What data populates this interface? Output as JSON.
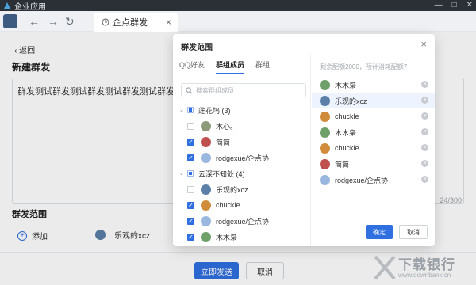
{
  "app": {
    "title": "企业应用"
  },
  "tab": {
    "label": "企点群发"
  },
  "page": {
    "back_label": "返回",
    "title": "新建群发",
    "message": "群发测试群发测试群发测试群发测试群发测试群发测试",
    "counter": "24/300",
    "range_title": "群发范围",
    "add_label": "添加",
    "selected_member": "乐观的xcz",
    "send_label": "立即发送",
    "cancel_label": "取消"
  },
  "modal": {
    "title": "群发范围",
    "tabs": [
      "QQ好友",
      "群组成员",
      "群组"
    ],
    "active_tab": "群组成员",
    "search_placeholder": "搜索群组成员",
    "hint": "剩余配额2000，预计消耗配额7",
    "groups": [
      {
        "name": "莲花坞 (3)",
        "members": [
          {
            "name": "木心。",
            "checked": false,
            "avatar": "#8a9a7a"
          },
          {
            "name": "简简",
            "checked": true,
            "avatar": "#c0504d"
          },
          {
            "name": "rodgexue/企点协",
            "checked": true,
            "avatar": "#9ab7e0"
          }
        ]
      },
      {
        "name": "云深不知处 (4)",
        "members": [
          {
            "name": "乐观的xcz",
            "checked": false,
            "avatar": "#5b7fa8"
          },
          {
            "name": "chuckle",
            "checked": true,
            "avatar": "#d08c3a"
          },
          {
            "name": "rodgexue/企点协",
            "checked": true,
            "avatar": "#9ab7e0"
          },
          {
            "name": "木木枭",
            "checked": true,
            "avatar": "#6fa06a"
          }
        ]
      }
    ],
    "selected": [
      {
        "name": "木木枭",
        "avatar": "#6fa06a"
      },
      {
        "name": "乐观的xcz",
        "avatar": "#5b7fa8"
      },
      {
        "name": "chuckle",
        "avatar": "#d08c3a"
      },
      {
        "name": "木木枭",
        "avatar": "#6fa06a"
      },
      {
        "name": "chuckle",
        "avatar": "#d08c3a"
      },
      {
        "name": "简简",
        "avatar": "#c0504d"
      },
      {
        "name": "rodgexue/企点协",
        "avatar": "#9ab7e0"
      }
    ],
    "confirm_label": "确定",
    "cancel_label": "取消"
  },
  "watermark": {
    "brand": "下载银行",
    "url": "www.downbank.cn"
  },
  "colors": {
    "accent": "#2f6fe0",
    "titlebar": "#2b2f36"
  }
}
